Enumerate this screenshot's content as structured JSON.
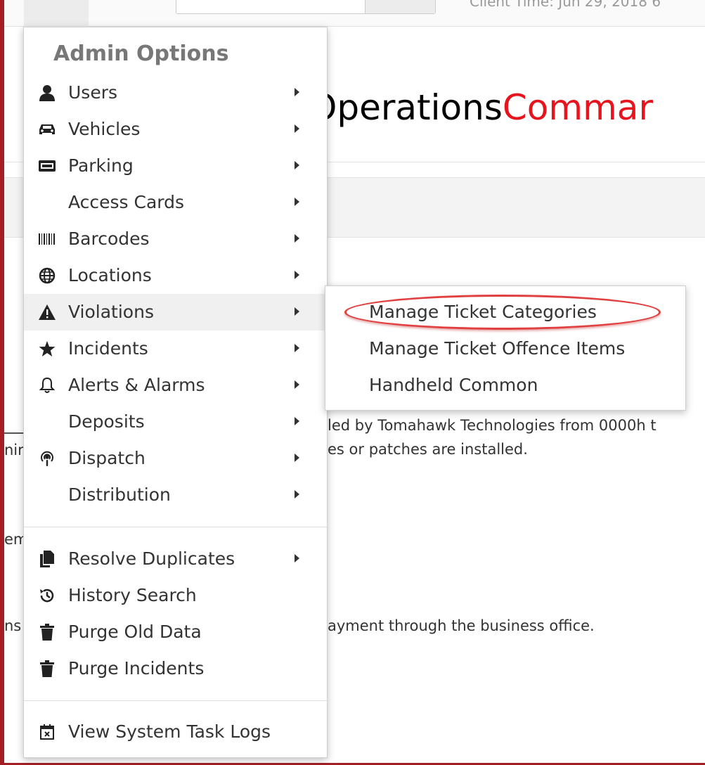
{
  "topbar": {
    "datetime": "Client Time: Jun 29, 2018 6"
  },
  "app": {
    "title_part1": "OperationsComman",
    "title_part2": "Commar",
    "title_left": "Operations"
  },
  "background_text": {
    "line1": "led by Tomahawk Technologies from 0000h t",
    "line2": "es or patches are installed.",
    "line3": "ayment through the business office.",
    "frag1": "nir",
    "frag2": "em",
    "frag3": "ns"
  },
  "admin_menu": {
    "title": "Admin Options",
    "items": [
      {
        "label": "Users",
        "icon": "user-icon",
        "arrow": true
      },
      {
        "label": "Vehicles",
        "icon": "car-icon",
        "arrow": true
      },
      {
        "label": "Parking",
        "icon": "parking-icon",
        "arrow": true
      },
      {
        "label": "Access Cards",
        "icon": "",
        "arrow": true
      },
      {
        "label": "Barcodes",
        "icon": "barcode-icon",
        "arrow": true
      },
      {
        "label": "Locations",
        "icon": "globe-icon",
        "arrow": true
      },
      {
        "label": "Violations",
        "icon": "warning-icon",
        "arrow": true,
        "active": true
      },
      {
        "label": "Incidents",
        "icon": "star-icon",
        "arrow": true
      },
      {
        "label": "Alerts & Alarms",
        "icon": "bell-icon",
        "arrow": true
      },
      {
        "label": "Deposits",
        "icon": "",
        "arrow": true
      },
      {
        "label": "Dispatch",
        "icon": "podcast-icon",
        "arrow": true
      },
      {
        "label": "Distribution",
        "icon": "",
        "arrow": true
      }
    ],
    "items2": [
      {
        "label": "Resolve Duplicates",
        "icon": "copy-icon",
        "arrow": true
      },
      {
        "label": "History Search",
        "icon": "history-icon",
        "arrow": false
      },
      {
        "label": "Purge Old Data",
        "icon": "trash-icon",
        "arrow": false
      },
      {
        "label": "Purge Incidents",
        "icon": "trash-icon",
        "arrow": false
      }
    ],
    "items3": [
      {
        "label": "View System Task Logs",
        "icon": "calendar-x-icon",
        "arrow": false
      }
    ]
  },
  "submenu": {
    "items": [
      {
        "label": "Manage Ticket Categories"
      },
      {
        "label": "Manage Ticket Offence Items"
      },
      {
        "label": "Handheld Common"
      }
    ]
  },
  "colors": {
    "brand_red": "#e8141d",
    "frame": "#a31f24",
    "annotation": "#e04040"
  }
}
